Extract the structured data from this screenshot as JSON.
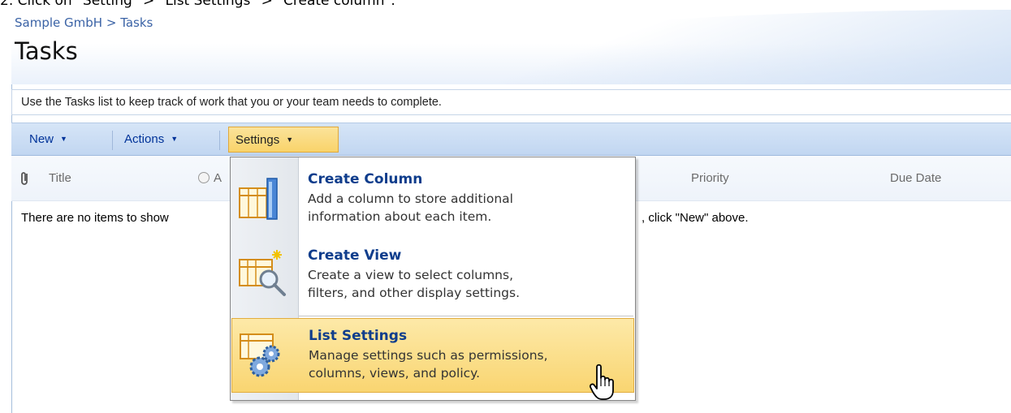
{
  "instruction": "2. Click on \"Setting\" > \"List Settings\" > \"Create column\".",
  "breadcrumb": {
    "parent": "Sample GmbH",
    "separator": ">",
    "current": "Tasks"
  },
  "page_title": "Tasks",
  "description": "Use the Tasks list to keep track of work that you or your team needs to complete.",
  "toolbar": {
    "new": "New",
    "actions": "Actions",
    "settings": "Settings"
  },
  "columns": {
    "title": "Title",
    "assigned_partial": "A",
    "priority": "Priority",
    "due_date": "Due Date"
  },
  "empty_message": {
    "left": "There are no items to show",
    "right": ", click \"New\" above."
  },
  "settings_menu": {
    "items": [
      {
        "title": "Create Column",
        "desc_line1": "Add a column to store additional",
        "desc_line2": "information about each item.",
        "icon": "create-column-icon"
      },
      {
        "title": "Create View",
        "desc_line1": "Create a view to select columns,",
        "desc_line2": "filters, and other display settings.",
        "icon": "create-view-icon"
      },
      {
        "title": "List Settings",
        "desc_line1": "Manage settings such as permissions,",
        "desc_line2": "columns, views, and policy.",
        "icon": "list-settings-icon"
      }
    ]
  },
  "colors": {
    "link_blue": "#003399",
    "menu_title": "#0f3d8c",
    "highlight": "#f9d571",
    "toolbar": "#c8dbf3"
  }
}
